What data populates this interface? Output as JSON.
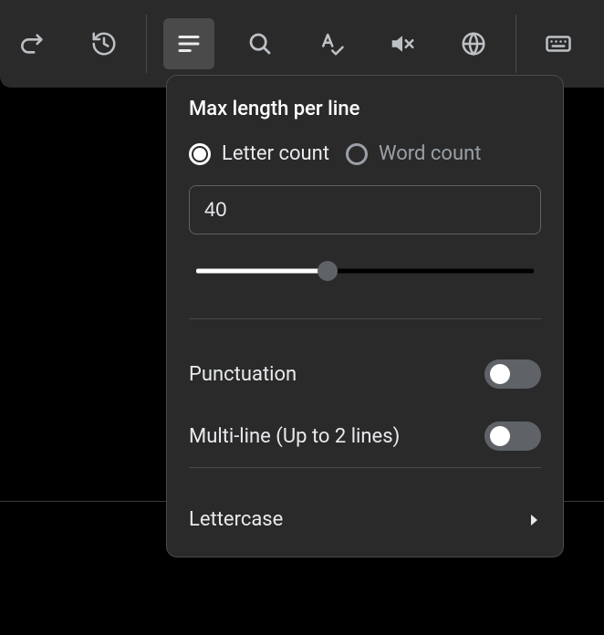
{
  "panel": {
    "title": "Max length per line",
    "radios": {
      "letter": "Letter count",
      "word": "Word count",
      "selected": "letter"
    },
    "value": "40",
    "slider_percent": 39,
    "rows": {
      "punctuation": "Punctuation",
      "multiline": "Multi-line (Up to 2 lines)",
      "lettercase": "Lettercase"
    }
  }
}
